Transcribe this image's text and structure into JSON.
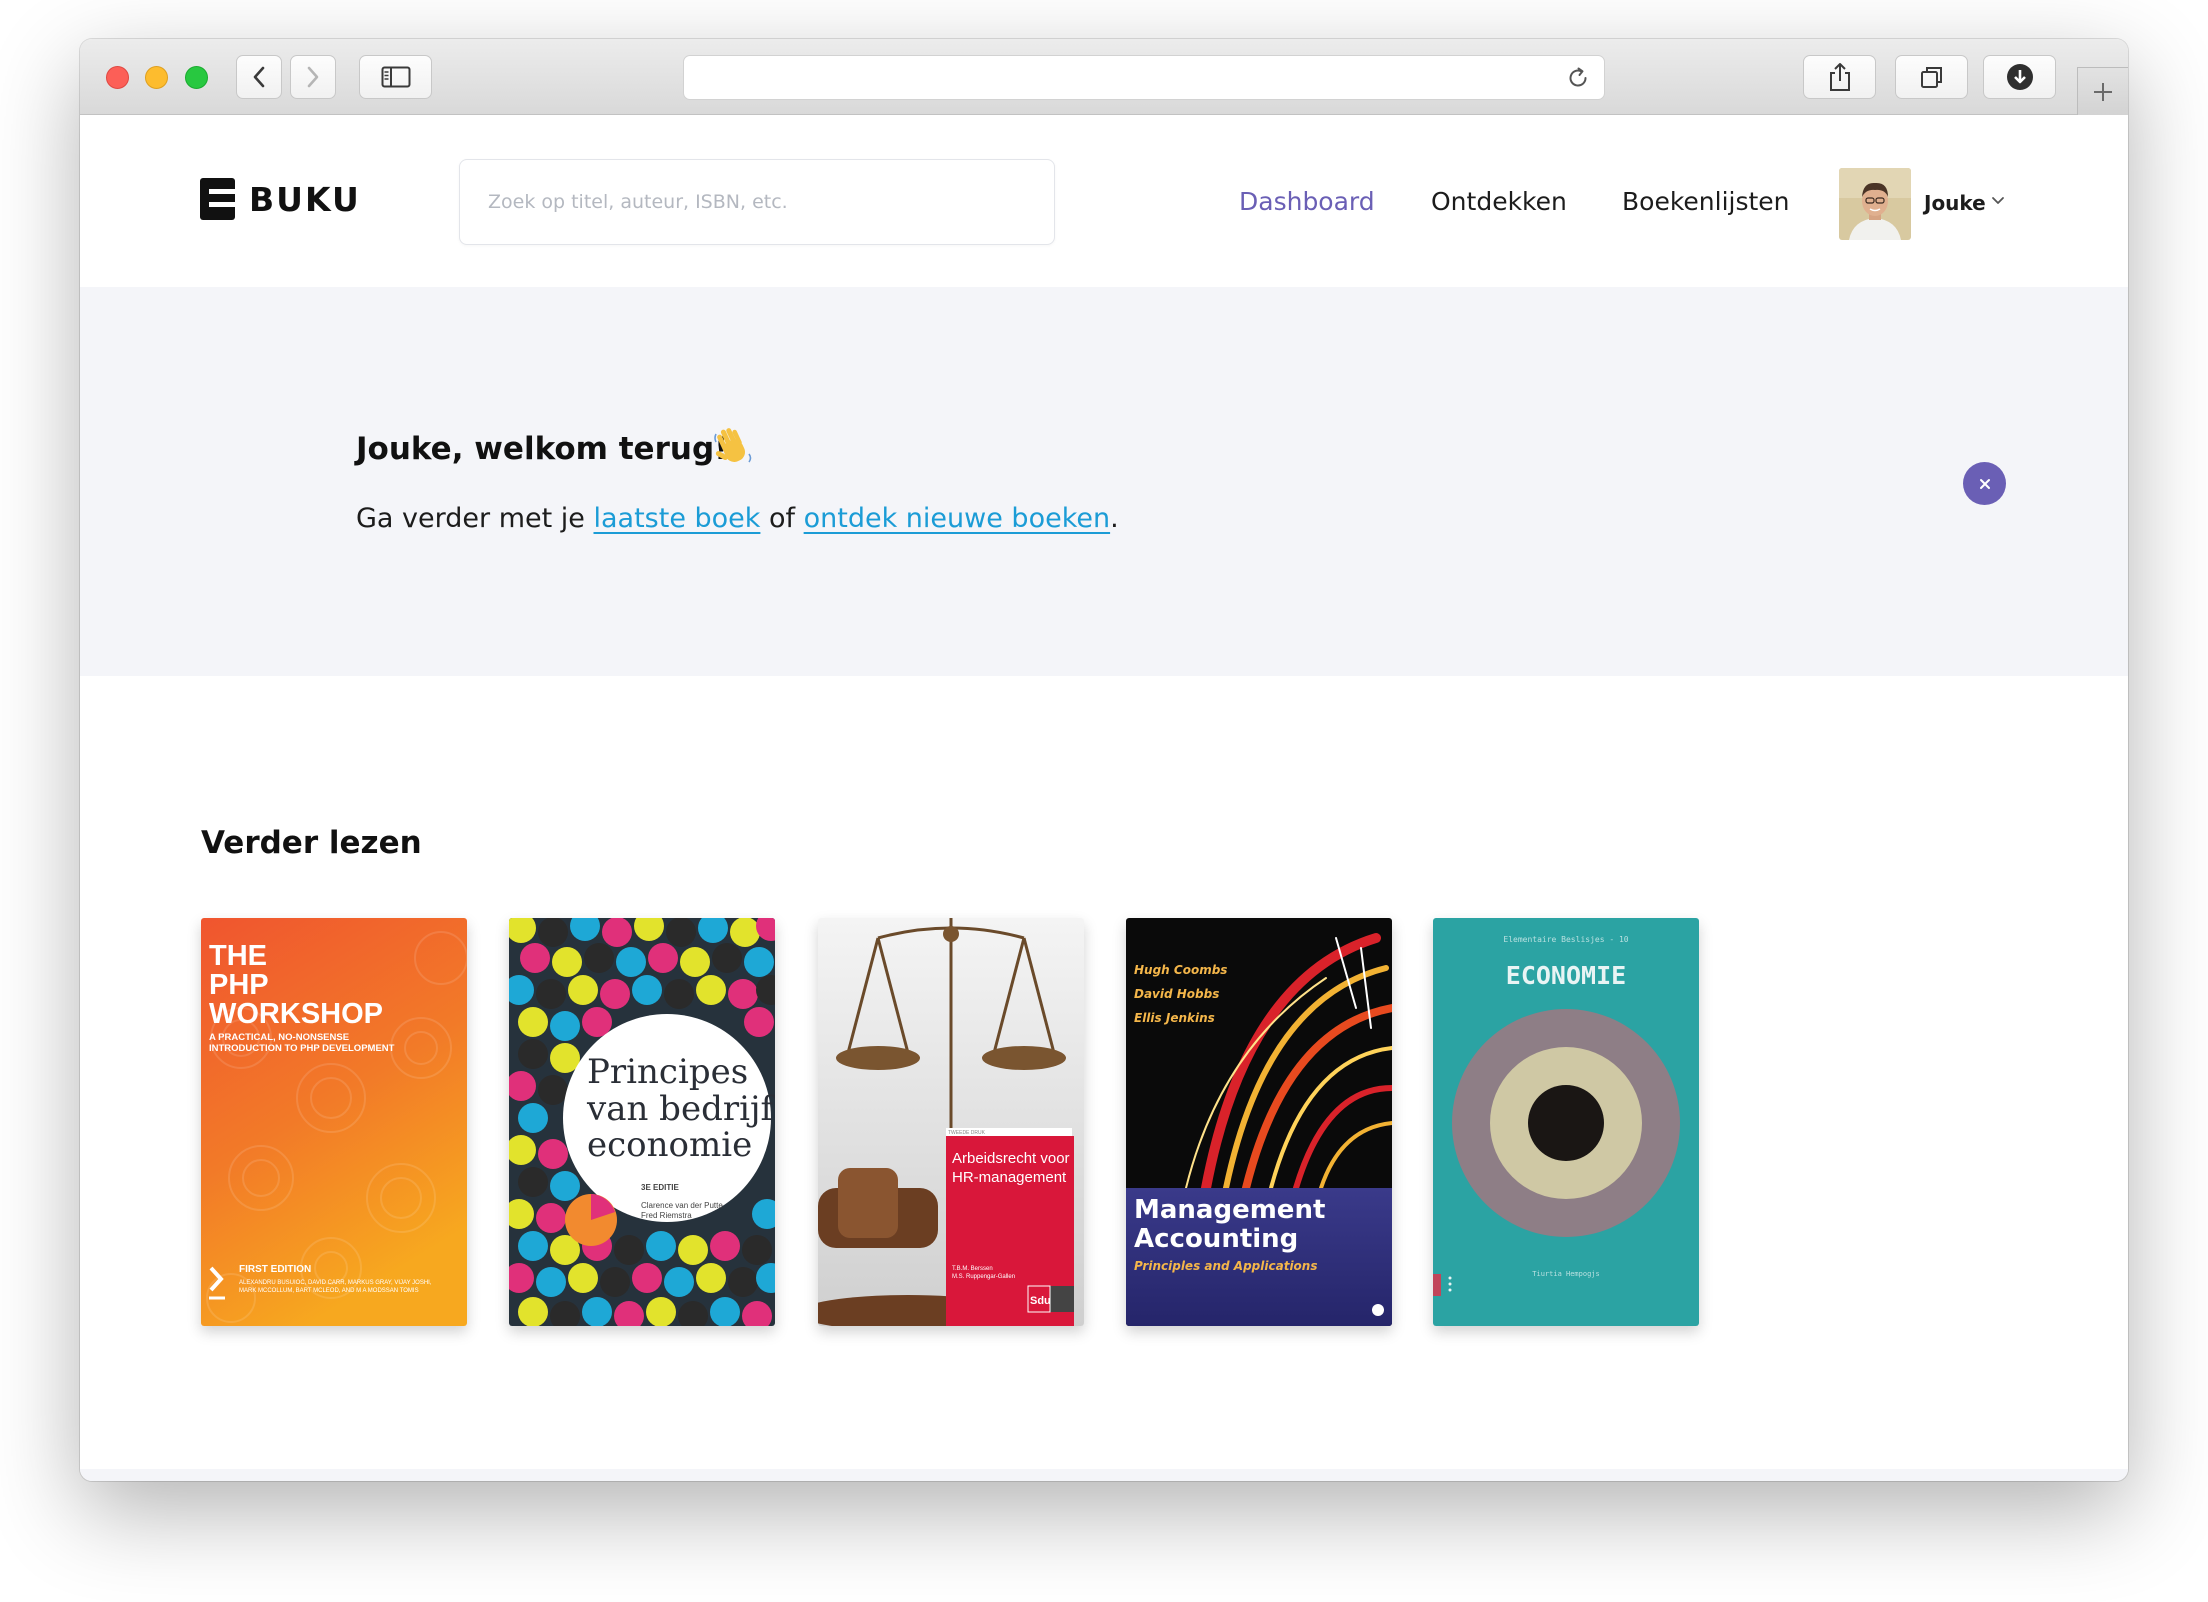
{
  "browser": {
    "address_text": ""
  },
  "header": {
    "logo_text": "BUKU",
    "search_placeholder": "Zoek op titel, auteur, ISBN, etc.",
    "nav": [
      {
        "label": "Dashboard",
        "active": true
      },
      {
        "label": "Ontdekken",
        "active": false
      },
      {
        "label": "Boekenlijsten",
        "active": false
      }
    ],
    "user_name": "Jouke"
  },
  "banner": {
    "title": "Jouke, welkom terug!",
    "emoji": "👋",
    "text_prefix": "Ga verder met je ",
    "link1": "laatste boek",
    "text_middle": " of ",
    "link2": "ontdek nieuwe boeken",
    "text_suffix": "."
  },
  "continue_reading": {
    "title": "Verder lezen",
    "books": [
      {
        "title_lines": [
          "THE",
          "PHP",
          "WORKSHOP"
        ],
        "subtitle_lines": [
          "A PRACTICAL, NO-NONSENSE",
          "INTRODUCTION TO PHP DEVELOPMENT"
        ],
        "edition": "FIRST EDITION",
        "authors_lines": [
          "ALEXANDRU BUSUIOC, DAVID CARR, MARKUS GRAY, VIJAY JOSHI,",
          "MARK MCCOLLUM, BART MCLEOD, AND M A MODSSAN TOMIS"
        ]
      },
      {
        "title_lines": [
          "Principes",
          "van bedrijfs",
          "economie"
        ],
        "edition": "3E EDITIE",
        "authors_lines": [
          "Clarence van der Putte",
          "Fred Riemstra"
        ]
      },
      {
        "series": "TWEEDE DRUK",
        "title_lines": [
          "Arbeidsrecht voor",
          "HR-management"
        ],
        "authors_lines": [
          "T.B.M. Berssen",
          "M.S. Ruppengar-Gallen"
        ],
        "publisher": "Sdu"
      },
      {
        "authors_lines": [
          "Hugh Coombs",
          "David Hobbs",
          "Ellis Jenkins"
        ],
        "title_lines": [
          "Management",
          "Accounting"
        ],
        "subtitle": "Principles and Applications"
      },
      {
        "series": "Elementaire Beslisjes - 10",
        "title": "ECONOMIE",
        "footer": "Tiurtia Hempogjs"
      }
    ]
  },
  "colors": {
    "accent": "#6a5fb5",
    "link": "#1b9cd6",
    "banner_bg": "#f4f5f9"
  },
  "icons": [
    "back-icon",
    "forward-icon",
    "sidebar-icon",
    "reload-icon",
    "share-icon",
    "tabs-icon",
    "download-icon",
    "plus-icon",
    "close-icon",
    "chevron-down-icon"
  ]
}
